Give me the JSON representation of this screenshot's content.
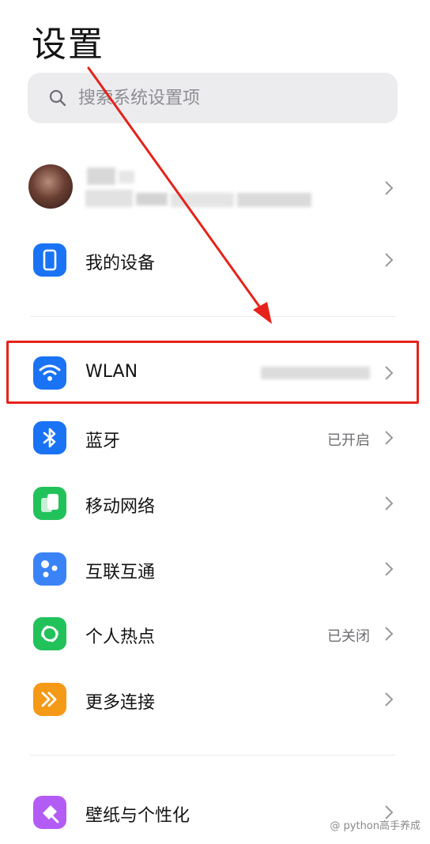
{
  "page": {
    "title": "设置"
  },
  "search": {
    "placeholder": "搜索系统设置项"
  },
  "account": {
    "name": ""
  },
  "items": [
    {
      "label": "我的设备",
      "icon": "phone-icon",
      "color": "#1a73f5",
      "status": ""
    },
    {
      "label": "WLAN",
      "icon": "wifi-icon",
      "color": "#1a73f5",
      "status": ""
    },
    {
      "label": "蓝牙",
      "icon": "bluetooth-icon",
      "color": "#1a73f5",
      "status": "已开启"
    },
    {
      "label": "移动网络",
      "icon": "mobile-network-icon",
      "color": "#22c25b",
      "status": ""
    },
    {
      "label": "互联互通",
      "icon": "interconnect-icon",
      "color": "#3a83f6",
      "status": ""
    },
    {
      "label": "个人热点",
      "icon": "hotspot-icon",
      "color": "#22c25b",
      "status": "已关闭"
    },
    {
      "label": "更多连接",
      "icon": "more-connections-icon",
      "color": "#f59a17",
      "status": ""
    },
    {
      "label": "壁纸与个性化",
      "icon": "wallpaper-icon",
      "color": "#b35cf5",
      "status": ""
    }
  ],
  "annotation": {
    "highlight_color": "#e5231b"
  },
  "watermark": {
    "text": "@ python高手养成"
  }
}
